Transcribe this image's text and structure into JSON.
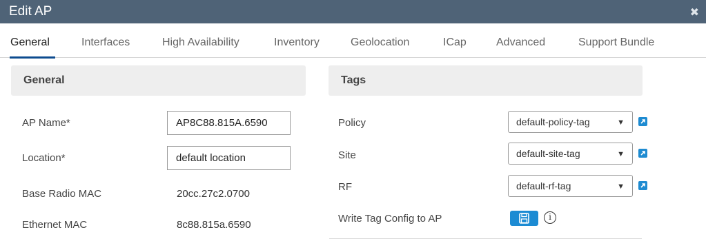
{
  "window": {
    "title": "Edit AP",
    "close_icon": "close-icon"
  },
  "tabs": [
    {
      "label": "General",
      "active": true
    },
    {
      "label": "Interfaces"
    },
    {
      "label": "High Availability"
    },
    {
      "label": "Inventory"
    },
    {
      "label": "Geolocation"
    },
    {
      "label": "ICap"
    },
    {
      "label": "Advanced"
    },
    {
      "label": "Support Bundle"
    }
  ],
  "general": {
    "heading": "General",
    "ap_name": {
      "label": "AP Name*",
      "value": "AP8C88.815A.6590"
    },
    "location": {
      "label": "Location*",
      "value": "default location"
    },
    "base_radio_mac": {
      "label": "Base Radio MAC",
      "value": "20cc.27c2.0700"
    },
    "ethernet_mac": {
      "label": "Ethernet MAC",
      "value": "8c88.815a.6590"
    }
  },
  "tags": {
    "heading": "Tags",
    "policy": {
      "label": "Policy",
      "value": "default-policy-tag"
    },
    "site": {
      "label": "Site",
      "value": "default-site-tag"
    },
    "rf": {
      "label": "RF",
      "value": "default-rf-tag"
    },
    "write_tag_config": {
      "label": "Write Tag Config to AP",
      "info_glyph": "i"
    }
  },
  "colors": {
    "titlebar": "#4f6377",
    "accent": "#1c8bd3",
    "tab_underline": "#0d4b8f"
  }
}
